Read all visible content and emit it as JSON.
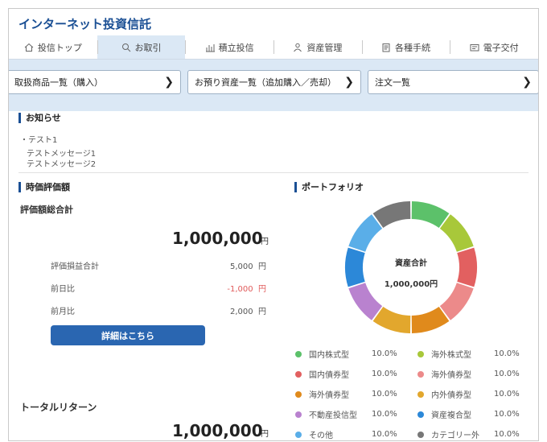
{
  "app": {
    "title": "インターネット投資信託"
  },
  "tabs": [
    {
      "label": "投信トップ",
      "icon": "home-icon",
      "active": false
    },
    {
      "label": "お取引",
      "icon": "search-icon",
      "active": true
    },
    {
      "label": "積立投信",
      "icon": "bar-chart-icon",
      "active": false
    },
    {
      "label": "資産管理",
      "icon": "person-icon",
      "active": false
    },
    {
      "label": "各種手続",
      "icon": "document-icon",
      "active": false
    },
    {
      "label": "電子交付",
      "icon": "envelope-icon",
      "active": false
    }
  ],
  "quick_links": [
    {
      "label": "取扱商品一覧（購入）"
    },
    {
      "label": "お預り資産一覧（追加購入／売却）"
    },
    {
      "label": "注文一覧"
    }
  ],
  "news": {
    "heading": "お知らせ",
    "item_title": "テスト1",
    "messages": [
      "テストメッセージ1",
      "テストメッセージ2"
    ]
  },
  "valuation": {
    "heading": "時価評価額",
    "total_label": "評価額総合計",
    "total_value": "1,000,000",
    "unit": "円",
    "rows": [
      {
        "label": "評価損益合計",
        "value": "5,000",
        "unit": "円",
        "negative": false
      },
      {
        "label": "前日比",
        "value": "-1,000",
        "unit": "円",
        "negative": true
      },
      {
        "label": "前月比",
        "value": "2,000",
        "unit": "円",
        "negative": false
      }
    ],
    "detail_button": "詳細はこちら"
  },
  "total_return": {
    "label": "トータルリターン",
    "value": "1,000,000",
    "unit": "円"
  },
  "portfolio": {
    "heading": "ポートフォリオ",
    "center_label": "資産合計",
    "center_value": "1,000,000円",
    "segments": [
      {
        "name": "国内株式型",
        "percent": "10.0%",
        "value": 10,
        "color": "#5cc16a"
      },
      {
        "name": "海外株式型",
        "percent": "10.0%",
        "value": 10,
        "color": "#a8c83a"
      },
      {
        "name": "国内債券型",
        "percent": "10.0%",
        "value": 10,
        "color": "#e26060"
      },
      {
        "name": "海外債券型",
        "percent": "10.0%",
        "value": 10,
        "color": "#ec8a8a"
      },
      {
        "name": "海外債券型",
        "percent": "10.0%",
        "value": 10,
        "color": "#e08a1c"
      },
      {
        "name": "内外債券型",
        "percent": "10.0%",
        "value": 10,
        "color": "#e2a72d"
      },
      {
        "name": "不動産投信型",
        "percent": "10.0%",
        "value": 10,
        "color": "#b982cf"
      },
      {
        "name": "資産複合型",
        "percent": "10.0%",
        "value": 10,
        "color": "#2c88d8"
      },
      {
        "name": "その他",
        "percent": "10.0%",
        "value": 10,
        "color": "#5aaee8"
      },
      {
        "name": "カテゴリー外",
        "percent": "10.0%",
        "value": 10,
        "color": "#777777"
      }
    ]
  }
}
